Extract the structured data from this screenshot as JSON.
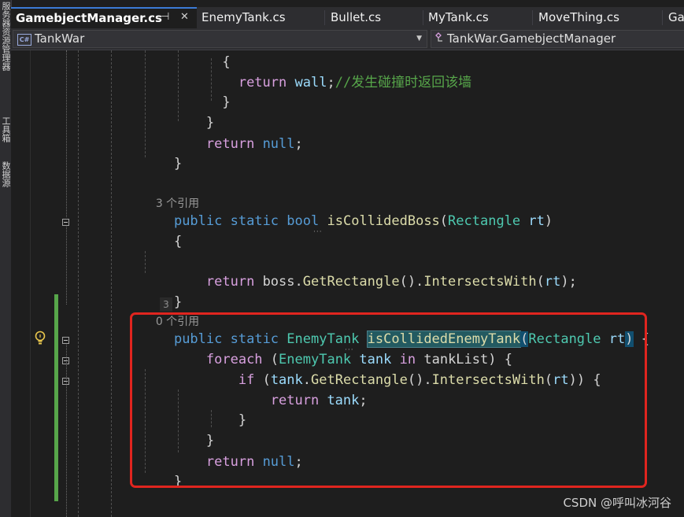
{
  "side_strip": {
    "items": [
      "服务器资源管理器",
      "工具箱",
      "数据源"
    ]
  },
  "tabs": [
    {
      "label": "GamebjectManager.cs",
      "active": true,
      "pin_icon": "pin-icon",
      "close_icon": "close-icon"
    },
    {
      "label": "EnemyTank.cs",
      "active": false
    },
    {
      "label": "Bullet.cs",
      "active": false
    },
    {
      "label": "MyTank.cs",
      "active": false
    },
    {
      "label": "MoveThing.cs",
      "active": false
    },
    {
      "label": "Ga",
      "active": false
    }
  ],
  "navbar": {
    "project": {
      "badge": "C#",
      "label": "TankWar"
    },
    "type": {
      "label": "TankWar.GamebjectManager",
      "icon": "class-icon"
    }
  },
  "editor": {
    "references": {
      "boss": "3 个引用",
      "enemy": "0 个引用"
    },
    "inline_badge": "3",
    "lines": {
      "l1_brace": "{",
      "l2_return": "return",
      "l2_var": "wall",
      "l2_semi": ";",
      "l2_comment": "//发生碰撞时返回该墙",
      "l3_brace": "}",
      "l4_brace": "}",
      "l5_return": "return",
      "l5_null": "null",
      "l5_semi": ";",
      "l6_brace": "}",
      "m1_public": "public",
      "m1_static": "static",
      "m1_bool": "bool",
      "m1_name": "isCollidedBoss",
      "m1_open": "(",
      "m1_ptype": "Rectangle",
      "m1_pname": "rt",
      "m1_close": ")",
      "m1_brace_open": "{",
      "m1_return": "return",
      "m1_boss": "boss.",
      "m1_getrect": "GetRectangle",
      "m1_parens": "().",
      "m1_intersects": "IntersectsWith",
      "m1_arg_open": "(",
      "m1_arg": "rt",
      "m1_arg_close": ");",
      "m1_brace_close": "}",
      "m2_public": "public",
      "m2_static": "static",
      "m2_type": "EnemyTank",
      "m2_name": "isCollidedEnemyTank",
      "m2_open": "(",
      "m2_ptype": "Rectangle",
      "m2_pname": "rt",
      "m2_close": ")",
      "m2_brace": "{",
      "f_foreach": "foreach",
      "f_open": "(",
      "f_type": "EnemyTank",
      "f_var": "tank",
      "f_in": "in",
      "f_list": "tankList",
      "f_close": ")",
      "f_brace": "{",
      "i_if": "if",
      "i_open": "(",
      "i_var": "tank",
      "i_dot": ".",
      "i_getrect": "GetRectangle",
      "i_parens": "().",
      "i_intersects": "IntersectsWith",
      "i_arg_open": "(",
      "i_arg": "rt",
      "i_close": "))",
      "i_brace": "{",
      "r_return": "return",
      "r_var": "tank",
      "r_semi": ";",
      "i_brace_close": "}",
      "f_brace_close": "}",
      "m2_return": "return",
      "m2_null": "null",
      "m2_semi": ";",
      "m2_brace_close": "}"
    }
  },
  "watermark": "CSDN @呼叫冰河谷",
  "colors": {
    "keyword": "#569cd6",
    "control": "#d8a0df",
    "type": "#4ec9b0",
    "method": "#dcdcaa",
    "variable": "#9cdcfe",
    "comment": "#57a64a",
    "highlight_box": "#e0251f"
  }
}
